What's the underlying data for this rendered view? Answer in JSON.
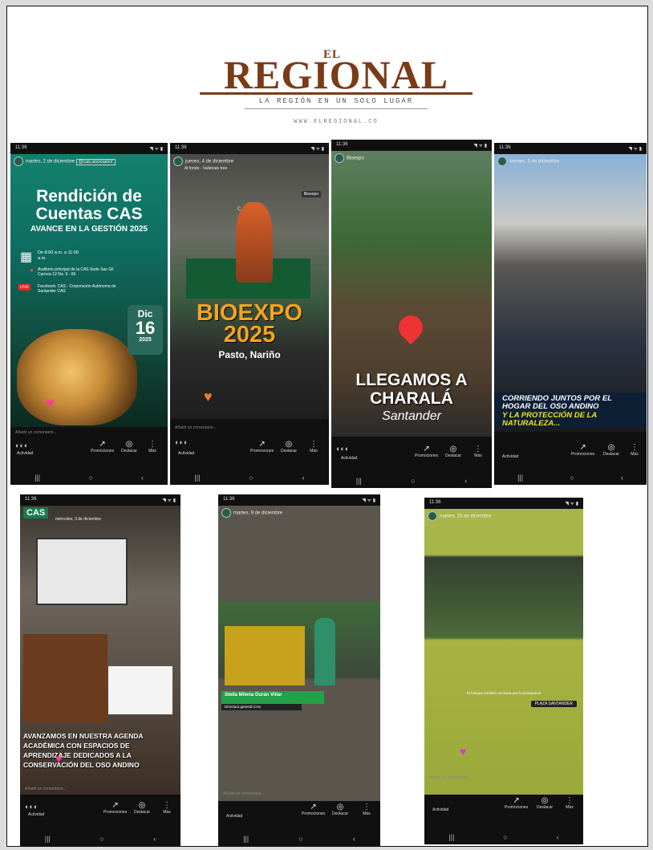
{
  "masthead": {
    "el": "EL",
    "name": "REGIONAL",
    "slogan": "LA REGIÓN EN UN SOLO LUGAR",
    "website": "WWW.ELREGIONAL.CO"
  },
  "common": {
    "time": "11:36",
    "signal": "◥ ᯤ ▮",
    "add_comment": "Añadir un comentario...",
    "actividad": "Actividad",
    "promociones": "Promociones",
    "destacar": "Destacar",
    "mas": "Más",
    "nav_recent": "|||",
    "nav_home": "○",
    "nav_back": "‹"
  },
  "stories": [
    {
      "header_date": "martes, 2 de diciembre",
      "header_tag": "@cas.asociador",
      "title": "Rendición de Cuentas CAS",
      "subtitle": "AVANCE EN LA GESTIÓN 2025",
      "time_info": "De 8:00 a.m. a 11:00 a.m.",
      "place": "Auditorio principal de la CAS Sede San Gil Carrera 12 No. 9 - 06",
      "stream": "Facebook: CAS - Corporación Autónoma de Santander CAS",
      "live": "LIVE",
      "date_month": "Dic",
      "date_day": "16",
      "date_year": "2025"
    },
    {
      "header_date": "jueves, 4 de diciembre",
      "header_sub": "Al fondo - Vallenato tree",
      "tag": "Bioexpo",
      "banner": "CAS",
      "title": "BIOEXPO 2025",
      "subtitle": "Pasto, Nariño"
    },
    {
      "header_date": "Bioexpo",
      "title": "LLEGAMOS A CHARALÁ",
      "subtitle": "Santander"
    },
    {
      "header_date": "viernes, 5 de diciembre",
      "line1": "CORRIENDO JUNTOS POR EL HOGAR DEL OSO ANDINO",
      "line2": "Y LA PROTECCIÓN DE LA NATURALEZA..."
    },
    {
      "logo": "CAS",
      "header_date": "miércoles, 3 de diciembre",
      "text": "AVANZAMOS EN NUESTRA AGENDA ACADÉMICA CON ESPACIOS DE APRENDIZAJE DEDICADOS A LA CONSERVACIÓN DEL OSO ANDINO"
    },
    {
      "header_date": "martes, 9 de diciembre",
      "name": "Stella Milena Durán Villar",
      "role": "Directora general CAS"
    },
    {
      "header_date": "martes, 16 de diciembre",
      "caption": "El bosque también necesita que lo protejamos",
      "pill": "PLAZA SANTANDER"
    }
  ]
}
